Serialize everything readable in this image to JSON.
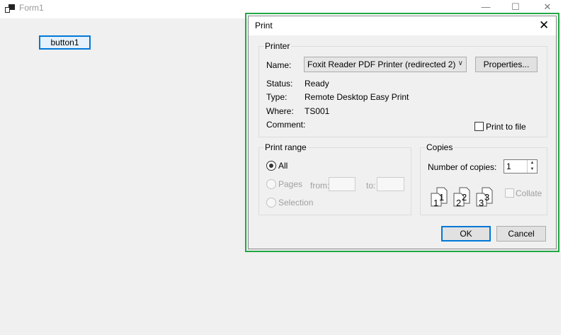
{
  "form": {
    "title": "Form1",
    "controls": {
      "minimize": "—",
      "maximize": "☐",
      "close": "✕"
    },
    "button1_label": "button1"
  },
  "dialog": {
    "title": "Print",
    "close_glyph": "✕",
    "printer": {
      "group_label": "Printer",
      "name_label": "Name:",
      "name_value": "Foxit Reader PDF Printer (redirected 2)",
      "properties_label": "Properties...",
      "status_label": "Status:",
      "status_value": "Ready",
      "type_label": "Type:",
      "type_value": "Remote Desktop Easy Print",
      "where_label": "Where:",
      "where_value": "TS001",
      "comment_label": "Comment:",
      "print_to_file_label": "Print to file",
      "print_to_file_checked": false
    },
    "print_range": {
      "group_label": "Print range",
      "all_label": "All",
      "pages_label": "Pages",
      "from_label": "from:",
      "to_label": "to:",
      "selection_label": "Selection",
      "selected": "All"
    },
    "copies": {
      "group_label": "Copies",
      "number_label": "Number of copies:",
      "number_value": "1",
      "collate_label": "Collate",
      "collate_checked": false,
      "collate_digits": [
        "1",
        "1",
        "2",
        "2",
        "3",
        "3"
      ]
    },
    "ok_label": "OK",
    "cancel_label": "Cancel"
  },
  "colors": {
    "highlight": "#22a845",
    "focus_border": "#0078d7",
    "window_bg": "#f0f0f0"
  }
}
